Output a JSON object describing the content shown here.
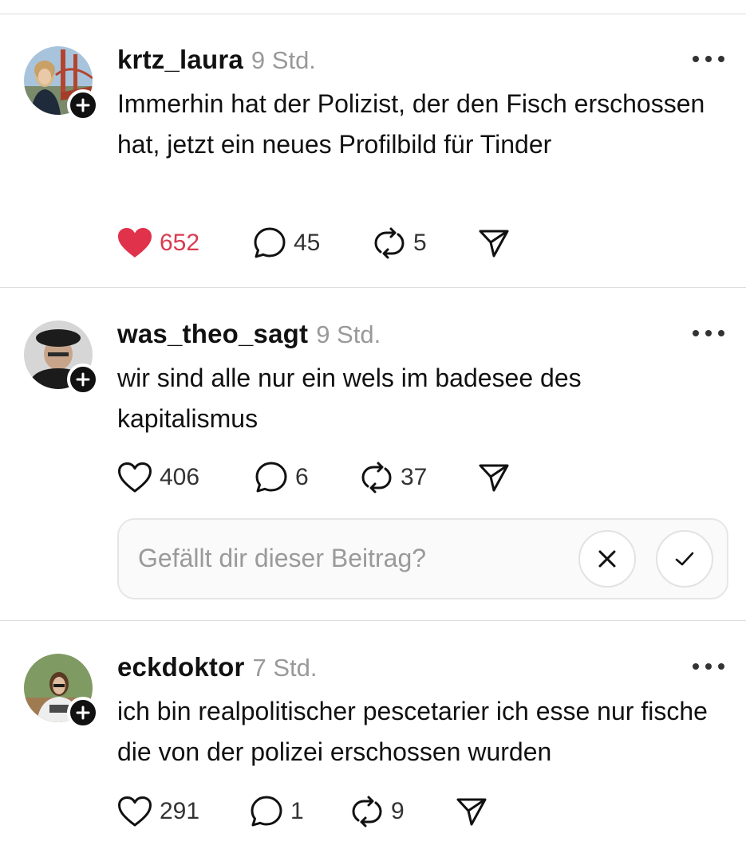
{
  "colors": {
    "text": "#111111",
    "muted": "#999999",
    "like_active": "#d93a50",
    "divider": "#dcdcdc"
  },
  "posts": [
    {
      "username": "krtz_laura",
      "time": "9 Std.",
      "text": "Immerhin hat der Polizist, der den Fisch erschossen hat, jetzt ein neues Profilbild für Tinder",
      "liked": true,
      "likes": "652",
      "replies": "45",
      "reposts": "5",
      "avatar_icon": "user-photo-bridge"
    },
    {
      "username": "was_theo_sagt",
      "time": "9 Std.",
      "text": "wir sind alle nur ein wels im badesee des kapitalismus",
      "liked": false,
      "likes": "406",
      "replies": "6",
      "reposts": "37",
      "avatar_icon": "user-photo-cap"
    },
    {
      "username": "eckdoktor",
      "time": "7 Std.",
      "text": "ich bin realpolitischer pescetarier ich esse nur fische die von der polizei erschossen wurden",
      "liked": false,
      "likes": "291",
      "replies": "1",
      "reposts": "9",
      "avatar_icon": "user-photo-green"
    }
  ],
  "feedback": {
    "question": "Gefällt dir dieser Beitrag?",
    "dismiss_icon": "close-icon",
    "confirm_icon": "check-icon"
  }
}
